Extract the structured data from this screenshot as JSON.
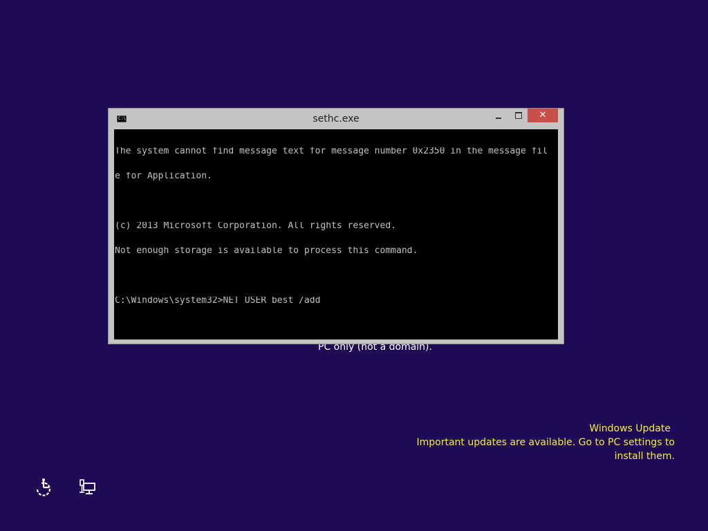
{
  "background_color": "#1f0a54",
  "behind_window_text": "PC only (not a domain).",
  "console": {
    "title": "sethc.exe",
    "icon": "command-prompt-icon",
    "controls": {
      "minimize": "minimize-icon",
      "maximize": "maximize-icon",
      "close_label": "✕"
    },
    "lines": [
      "The system cannot find message text for message number 0x2350 in the message fil",
      "e for Application.",
      "",
      "(c) 2013 Microsoft Corporation. All rights reserved.",
      "Not enough storage is available to process this command.",
      "",
      "C:\\Windows\\system32>NET USER best /add"
    ]
  },
  "notification": {
    "title": "Windows Update",
    "body_line1": "Important updates are available. Go to PC settings to",
    "body_line2": "install them.",
    "color": "#f2ee42"
  },
  "bottom_icons": {
    "ease_of_access": "ease-of-access-icon",
    "network": "network-icon"
  }
}
